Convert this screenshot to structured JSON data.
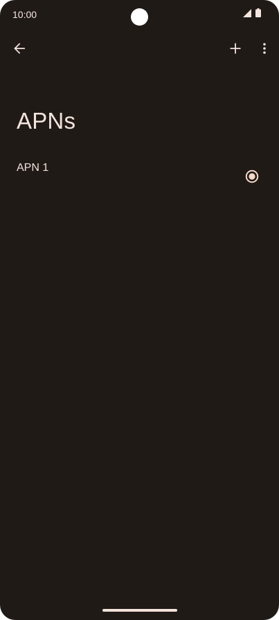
{
  "status_bar": {
    "time": "10:00",
    "icons": [
      "signal-icon",
      "battery-icon"
    ]
  },
  "app_bar": {
    "back_icon": "arrow-back-icon",
    "add_icon": "plus-icon",
    "overflow_icon": "more-vert-icon"
  },
  "page": {
    "title": "APNs"
  },
  "apn_list": {
    "items": [
      {
        "label": "APN 1",
        "selected": true
      }
    ]
  },
  "colors": {
    "background": "#201a17",
    "text": "#efe0d8",
    "accent": "#f6d9c8"
  }
}
